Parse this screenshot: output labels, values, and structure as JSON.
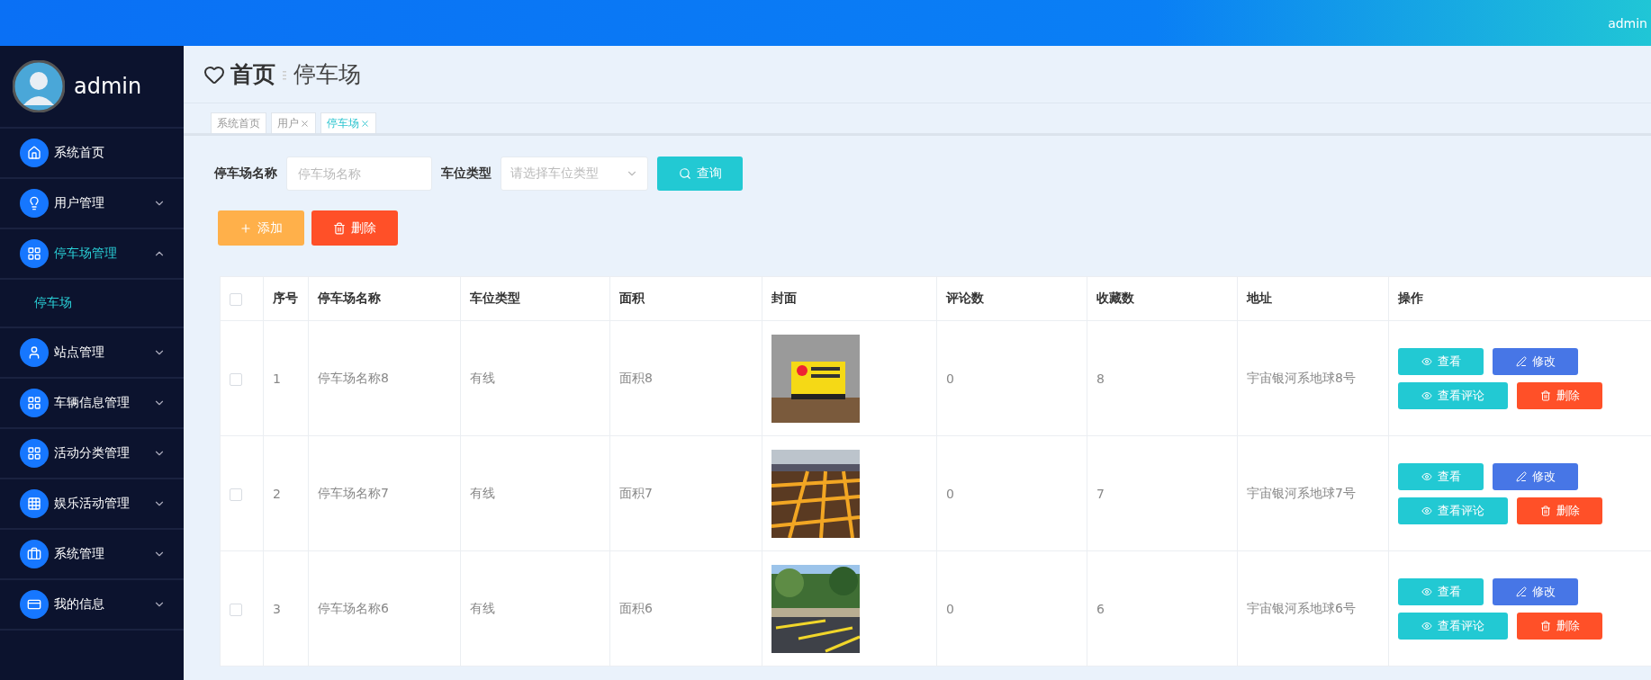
{
  "top_bar": {
    "user": "admin"
  },
  "sidebar": {
    "user": {
      "name": "admin"
    },
    "menu": [
      {
        "label": "系统首页",
        "kind": "link",
        "selected": false
      },
      {
        "label": "用户管理",
        "kind": "group",
        "expanded": false,
        "selected": false
      },
      {
        "label": "停车场管理",
        "kind": "group",
        "expanded": true,
        "selected": true,
        "children": [
          {
            "label": "停车场",
            "selected": true
          }
        ]
      },
      {
        "label": "站点管理",
        "kind": "group",
        "expanded": false,
        "selected": false
      },
      {
        "label": "车辆信息管理",
        "kind": "group",
        "expanded": false,
        "selected": false
      },
      {
        "label": "活动分类管理",
        "kind": "group",
        "expanded": false,
        "selected": false
      },
      {
        "label": "娱乐活动管理",
        "kind": "group",
        "expanded": false,
        "selected": false
      },
      {
        "label": "系统管理",
        "kind": "group",
        "expanded": false,
        "selected": false
      },
      {
        "label": "我的信息",
        "kind": "group",
        "expanded": false,
        "selected": false
      }
    ]
  },
  "breadcrumb": {
    "home": "首页",
    "current": "停车场"
  },
  "tabs": [
    {
      "label": "系统首页",
      "closable": false,
      "selected": false
    },
    {
      "label": "用户",
      "closable": true,
      "selected": false
    },
    {
      "label": "停车场",
      "closable": true,
      "selected": true
    }
  ],
  "search": {
    "fields": [
      {
        "label": "停车场名称",
        "kind": "input",
        "placeholder": "停车场名称"
      },
      {
        "label": "车位类型",
        "kind": "select",
        "placeholder": "请选择车位类型"
      }
    ],
    "button": "查询"
  },
  "toolbar": [
    {
      "label": "添加",
      "kind": "add"
    },
    {
      "label": "删除",
      "kind": "delete"
    }
  ],
  "table": {
    "header_checked": false,
    "columns": [
      "序号",
      "停车场名称",
      "车位类型",
      "面积",
      "封面",
      "评论数",
      "收藏数",
      "地址",
      "操作"
    ],
    "rows": [
      {
        "checked": false,
        "index": "1",
        "name": "停车场名称8",
        "type": "有线",
        "area": "面积8",
        "comments": "0",
        "favorites": "8",
        "address": "宇宙银河系地球8号",
        "actions": [
          {
            "label": "查看",
            "kind": "view"
          },
          {
            "label": "修改",
            "kind": "edit"
          },
          {
            "label": "查看评论",
            "kind": "comments"
          },
          {
            "label": "删除",
            "kind": "delete"
          }
        ]
      },
      {
        "checked": false,
        "index": "2",
        "name": "停车场名称7",
        "type": "有线",
        "area": "面积7",
        "comments": "0",
        "favorites": "7",
        "address": "宇宙银河系地球7号",
        "actions": [
          {
            "label": "查看",
            "kind": "view"
          },
          {
            "label": "修改",
            "kind": "edit"
          },
          {
            "label": "查看评论",
            "kind": "comments"
          },
          {
            "label": "删除",
            "kind": "delete"
          }
        ]
      },
      {
        "checked": false,
        "index": "3",
        "name": "停车场名称6",
        "type": "有线",
        "area": "面积6",
        "comments": "0",
        "favorites": "6",
        "address": "宇宙银河系地球6号",
        "actions": [
          {
            "label": "查看",
            "kind": "view"
          },
          {
            "label": "修改",
            "kind": "edit"
          },
          {
            "label": "查看评论",
            "kind": "comments"
          },
          {
            "label": "删除",
            "kind": "delete"
          }
        ]
      }
    ]
  }
}
